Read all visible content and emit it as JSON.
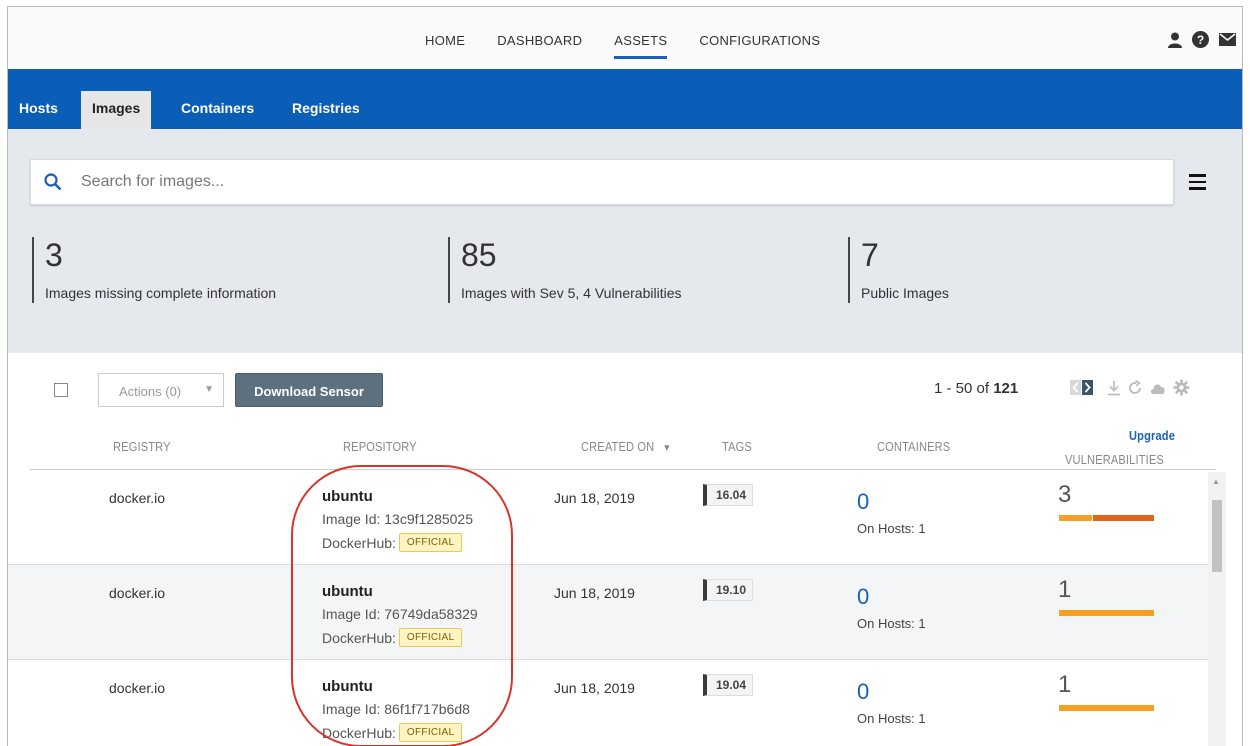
{
  "topnav": {
    "items": [
      {
        "label": "HOME",
        "active": false
      },
      {
        "label": "DASHBOARD",
        "active": false
      },
      {
        "label": "ASSETS",
        "active": true
      },
      {
        "label": "CONFIGURATIONS",
        "active": false
      }
    ],
    "icons": [
      "user-icon",
      "help-icon",
      "mail-icon"
    ]
  },
  "tabs": [
    {
      "label": "Hosts",
      "active": false
    },
    {
      "label": "Images",
      "active": true
    },
    {
      "label": "Containers",
      "active": false
    },
    {
      "label": "Registries",
      "active": false
    }
  ],
  "search": {
    "placeholder": "Search for images..."
  },
  "stats": [
    {
      "value": "3",
      "label": "Images missing complete information"
    },
    {
      "value": "85",
      "label": "Images with Sev 5, 4 Vulnerabilities"
    },
    {
      "value": "7",
      "label": "Public Images"
    }
  ],
  "toolbar": {
    "actions_label": "Actions (0)",
    "download_label": "Download Sensor",
    "pager_range": "1 - 50 of",
    "pager_total": "121"
  },
  "columns": {
    "registry": "REGISTRY",
    "repository": "REPOSITORY",
    "created_on": "CREATED ON",
    "tags": "TAGS",
    "containers": "CONTAINERS",
    "upgrade": "Upgrade",
    "vulnerabilities": "VULNERABILITIES"
  },
  "rows": [
    {
      "registry": "docker.io",
      "repo": "ubuntu",
      "image_id": "Image Id: 13c9f1285025",
      "hub": "DockerHub:",
      "badge": "OFFICIAL",
      "created": "Jun 18, 2019",
      "tag": "16.04",
      "containers": "0",
      "hosts": "On Hosts: 1",
      "vulns": "3"
    },
    {
      "registry": "docker.io",
      "repo": "ubuntu",
      "image_id": "Image Id: 76749da58329",
      "hub": "DockerHub:",
      "badge": "OFFICIAL",
      "created": "Jun 18, 2019",
      "tag": "19.10",
      "containers": "0",
      "hosts": "On Hosts: 1",
      "vulns": "1"
    },
    {
      "registry": "docker.io",
      "repo": "ubuntu",
      "image_id": "Image Id: 86f1f717b6d8",
      "hub": "DockerHub:",
      "badge": "OFFICIAL",
      "created": "Jun 18, 2019",
      "tag": "19.04",
      "containers": "0",
      "hosts": "On Hosts: 1",
      "vulns": "1"
    }
  ],
  "colors": {
    "accent": "#0a5eb8",
    "sev_orange": "#f5a023",
    "sev_dark_orange": "#e0661c",
    "highlight": "#d9342b"
  }
}
